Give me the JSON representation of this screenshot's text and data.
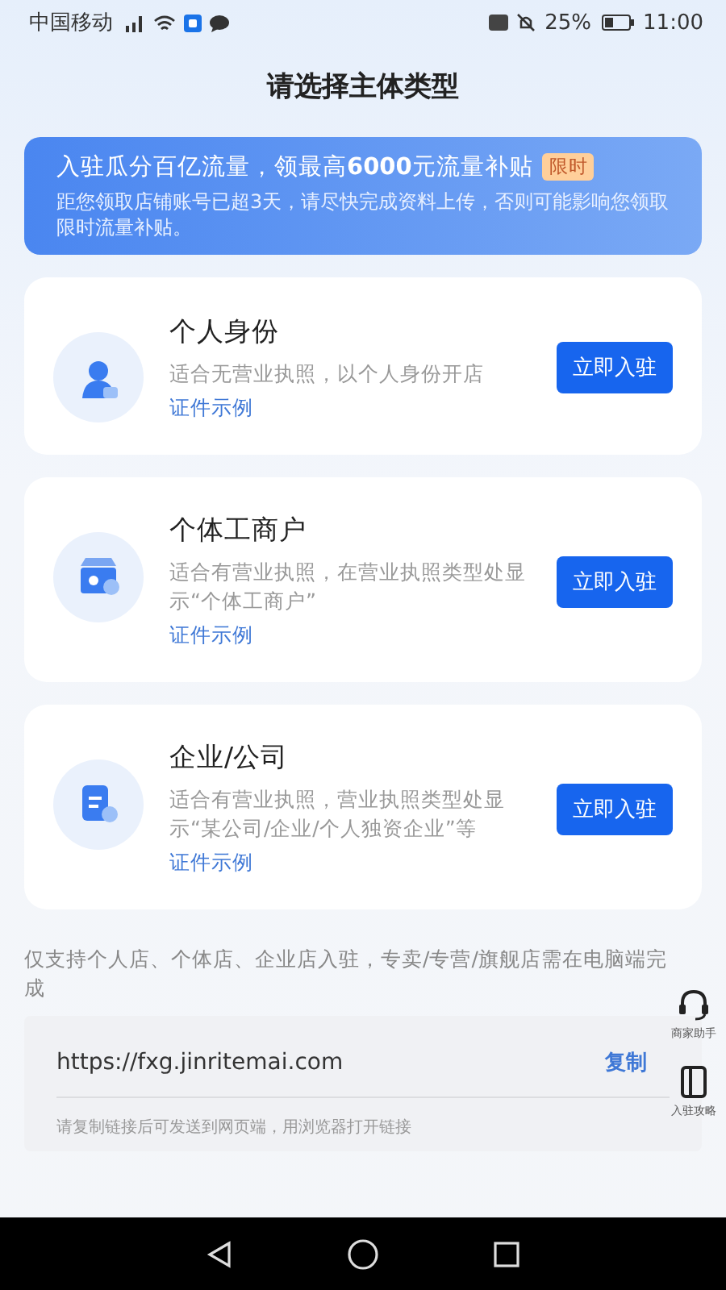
{
  "status_bar": {
    "carrier": "中国移动",
    "battery_percent": "25%",
    "time": "11:00"
  },
  "title": "请选择主体类型",
  "banner": {
    "headline": "入驻瓜分百亿流量，领最高**6000**元流量补贴",
    "badge": "限时",
    "message": "距您领取店铺账号已超3天，请尽快完成资料上传，否则可能影响您领取限时流量补贴。"
  },
  "options": [
    {
      "kind": "person",
      "name": "个人身份",
      "description": "适合无营业执照，以个人身份开店",
      "link": "证件示例",
      "button": "立即入驻"
    },
    {
      "kind": "shop",
      "name": "个体工商户",
      "description": "适合有营业执照，在营业执照类型处显示“个体工商户”",
      "link": "证件示例",
      "button": "立即入驻"
    },
    {
      "kind": "company",
      "name": "企业/公司",
      "description": "适合有营业执照，营业执照类型处显示“某公司/企业/个人独资企业”等",
      "link": "证件示例",
      "button": "立即入驻"
    }
  ],
  "note": "仅支持个人店、个体店、企业店入驻，专卖/专营/旗舰店需在电脑端完成",
  "link_box": {
    "url": "https://fxg.jinritemai.com",
    "copy": "复制",
    "hint": "请复制链接后可发送到网页端，用浏览器打开链接"
  },
  "side_tools": [
    {
      "kind": "headset",
      "label": "商家助手"
    },
    {
      "kind": "book",
      "label": "入驻攻略"
    }
  ]
}
